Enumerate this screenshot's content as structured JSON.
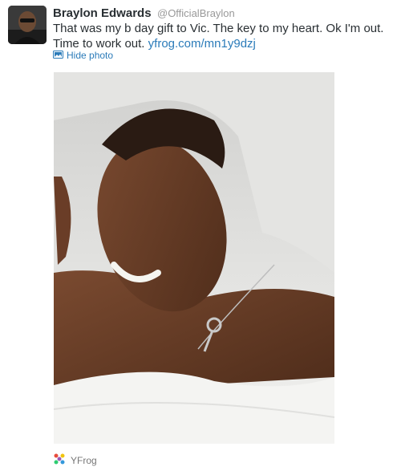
{
  "tweet": {
    "author": {
      "fullname": "Braylon Edwards",
      "username": "@OfficialBraylon",
      "avatar_icon": "avatar-photo"
    },
    "text": "That was my b day gift to Vic. The key to my heart. Ok I'm out. Time to work out.",
    "link": "yfrog.com/mn1y9dzj",
    "hide_photo_label": "Hide photo",
    "hide_photo_icon": "photo-icon",
    "provider": {
      "name": "YFrog",
      "icon": "yfrog-icon"
    },
    "colors": {
      "link": "#2b7bb9",
      "name": "#292f33",
      "username": "#999999"
    }
  }
}
